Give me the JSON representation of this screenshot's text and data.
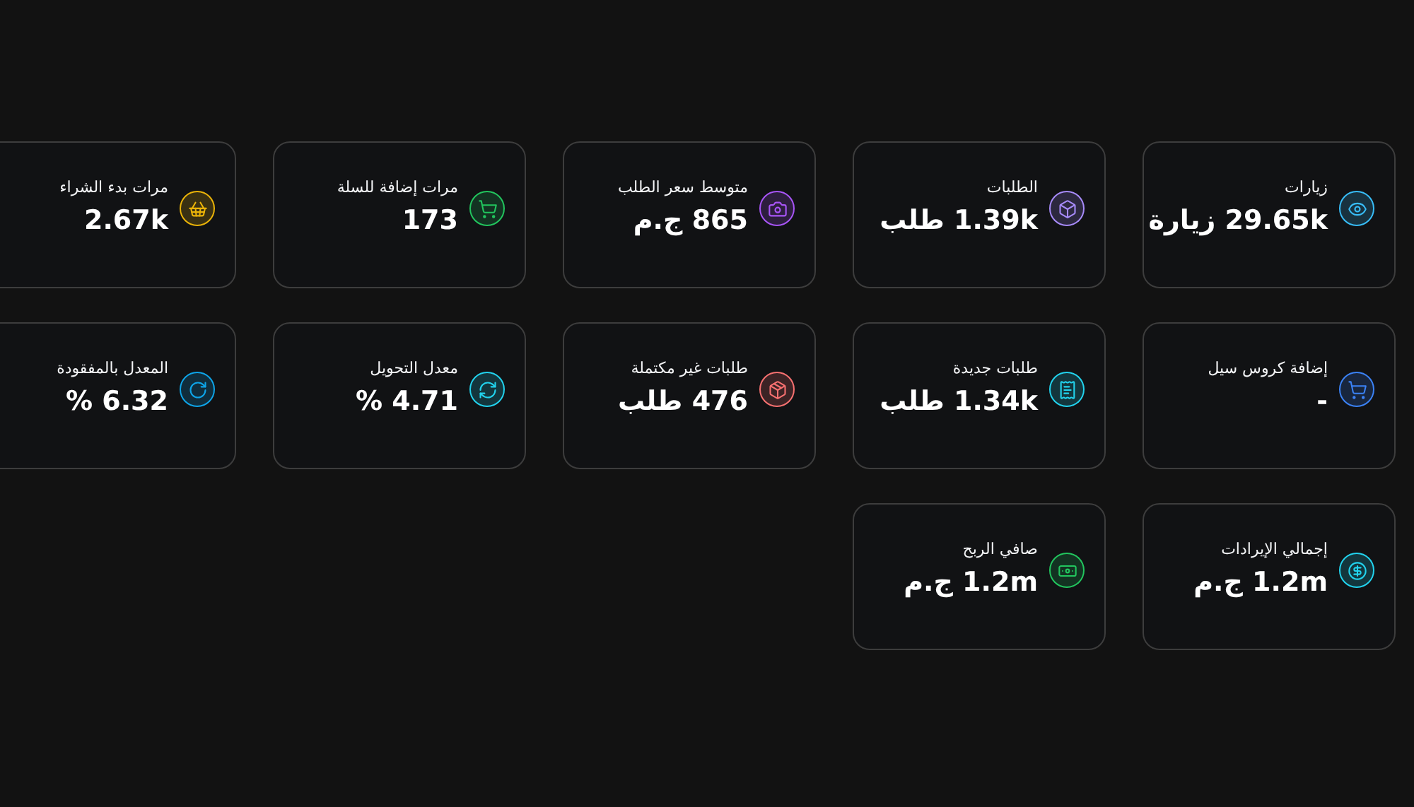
{
  "rows": [
    [
      {
        "label": "زيارات",
        "value": "29.65k زيارة",
        "color": "#38bdf8"
      },
      {
        "label": "الطلبات",
        "value": "1.39k طلب",
        "color": "#a78bfa"
      },
      {
        "label": "متوسط سعر الطلب",
        "value": "865 ج.م",
        "color": "#a855f7"
      },
      {
        "label": "مرات إضافة للسلة",
        "value": "173",
        "color": "#22c55e"
      },
      {
        "label": "مرات بدء الشراء",
        "value": "2.67k",
        "color": "#eab308"
      }
    ],
    [
      {
        "label": "إضافة كروس سيل",
        "value": "-",
        "color": "#3b82f6"
      },
      {
        "label": "طلبات جديدة",
        "value": "1.34k طلب",
        "color": "#22d3ee"
      },
      {
        "label": "طلبات غير مكتملة",
        "value": "476 طلب",
        "color": "#f87171"
      },
      {
        "label": "معدل التحويل",
        "value": "4.71 %",
        "color": "#22d3ee"
      },
      {
        "label": "المعدل بالمفقودة",
        "value": "6.32 %",
        "color": "#0ea5e9"
      }
    ],
    [
      {
        "label": "إجمالي الإيرادات",
        "value": "1.2m ج.م",
        "color": "#22d3ee"
      },
      {
        "label": "صافي الربح",
        "value": "1.2m ج.م",
        "color": "#22c55e"
      }
    ]
  ]
}
